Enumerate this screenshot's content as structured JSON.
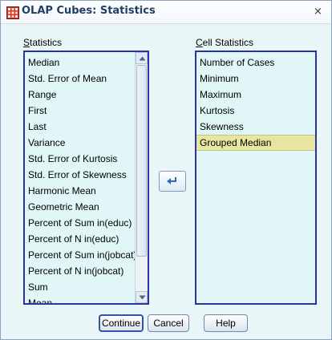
{
  "window": {
    "title": "OLAP Cubes: Statistics",
    "close_label": "×"
  },
  "statistics": {
    "label_mnemonic": "S",
    "label_rest": "tatistics",
    "items": [
      "Median",
      "Std. Error of Mean",
      "Range",
      "First",
      "Last",
      "Variance",
      "Std. Error of Kurtosis",
      "Std. Error of Skewness",
      "Harmonic Mean",
      "Geometric Mean",
      "Percent of Sum in(educ)",
      "Percent of N in(educ)",
      "Percent of Sum in(jobcat)",
      "Percent of N in(jobcat)",
      "Sum",
      "Mean"
    ]
  },
  "cell_statistics": {
    "label_mnemonic": "C",
    "label_rest": "ell Statistics",
    "items": [
      "Number of Cases",
      "Minimum",
      "Maximum",
      "Kurtosis",
      "Skewness",
      "Grouped Median"
    ],
    "selected_index": 5
  },
  "buttons": {
    "continue": "Continue",
    "cancel": "Cancel",
    "help": "Help"
  },
  "icons": {
    "title_icon": "olap-cube-grid-icon",
    "move_icon": "move-left-arrow-icon",
    "scroll_up": "scroll-up-arrow-icon",
    "scroll_down": "scroll-down-arrow-icon"
  },
  "colors": {
    "dialog_bg": "#e9f6f8",
    "list_border": "#2a33a4",
    "selected_bg": "#e7e6a0",
    "title_text": "#1d3f66"
  }
}
